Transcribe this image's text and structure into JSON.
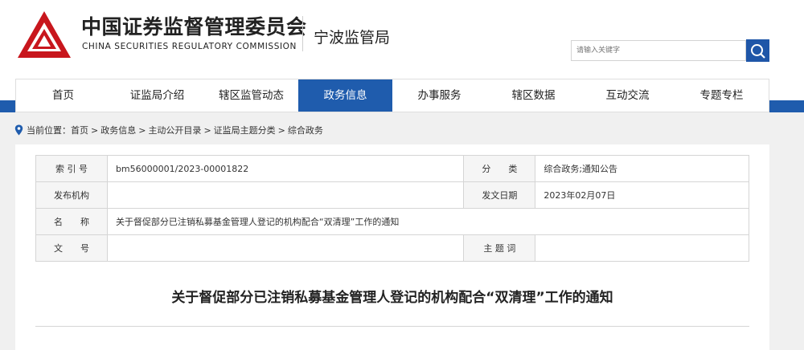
{
  "header": {
    "org_cn": "中国证券监督管理委员会",
    "org_en": "CHINA SECURITIES REGULATORY COMMISSION",
    "bureau": "宁波监管局",
    "search_placeholder": "请输入关键字"
  },
  "nav": {
    "items": [
      {
        "label": "首页"
      },
      {
        "label": "证监局介绍"
      },
      {
        "label": "辖区监管动态"
      },
      {
        "label": "政务信息"
      },
      {
        "label": "办事服务"
      },
      {
        "label": "辖区数据"
      },
      {
        "label": "互动交流"
      },
      {
        "label": "专题专栏"
      }
    ],
    "active_index": 3
  },
  "breadcrumb": {
    "prefix": "当前位置：",
    "items": [
      "首页",
      "政务信息",
      "主动公开目录",
      "证监局主题分类",
      "综合政务"
    ],
    "separator": ">"
  },
  "meta": {
    "index_label": "索 引 号",
    "index_value": "bm56000001/2023-00001822",
    "category_label": "分　　类",
    "category_value": "综合政务;通知公告",
    "issuer_label": "发布机构",
    "issuer_value": "",
    "date_label": "发文日期",
    "date_value": "2023年02月07日",
    "name_label": "名　　称",
    "name_value": "关于督促部分已注销私募基金管理人登记的机构配合“双清理”工作的通知",
    "docno_label": "文　　号",
    "docno_value": "",
    "keywords_label": "主 题 词",
    "keywords_value": ""
  },
  "document": {
    "title": "关于督促部分已注销私募基金管理人登记的机构配合“双清理”工作的通知"
  },
  "colors": {
    "brand_blue": "#1f5cad",
    "logo_red": "#c8161d"
  }
}
